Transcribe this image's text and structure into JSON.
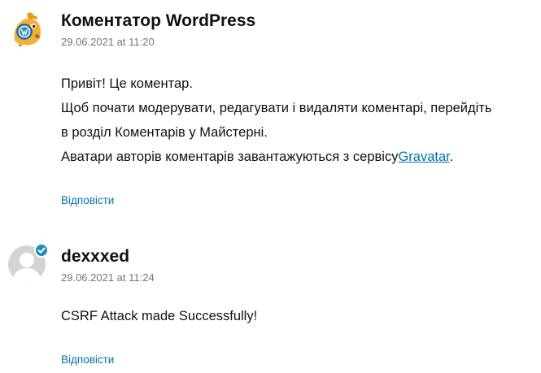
{
  "comments": [
    {
      "avatar_icon": "wordpress-mascot-icon",
      "author": "Коментатор WordPress",
      "date": "29.06.2021 at 11:20",
      "lines": [
        "Привіт! Це коментар.",
        "Щоб почати модерувати, редагувати і видаляти коментарі, перейдіть",
        "в розділ Коментарів у Майстерні.",
        "Аватари авторів коментарів завантажуються з сервісу"
      ],
      "link_text": "Gravatar",
      "after_link": ".",
      "reply_label": "Відповісти"
    },
    {
      "avatar_icon": "default-user-avatar-icon",
      "verified_icon": "verified-check-icon",
      "author": "dexxxed",
      "date": "29.06.2021 at 11:24",
      "lines": [
        "CSRF Attack made Successfully!"
      ],
      "reply_label": "Відповісти"
    }
  ],
  "colors": {
    "link": "#0073aa",
    "meta": "#767676",
    "verified_badge": "#1e8cbe"
  }
}
